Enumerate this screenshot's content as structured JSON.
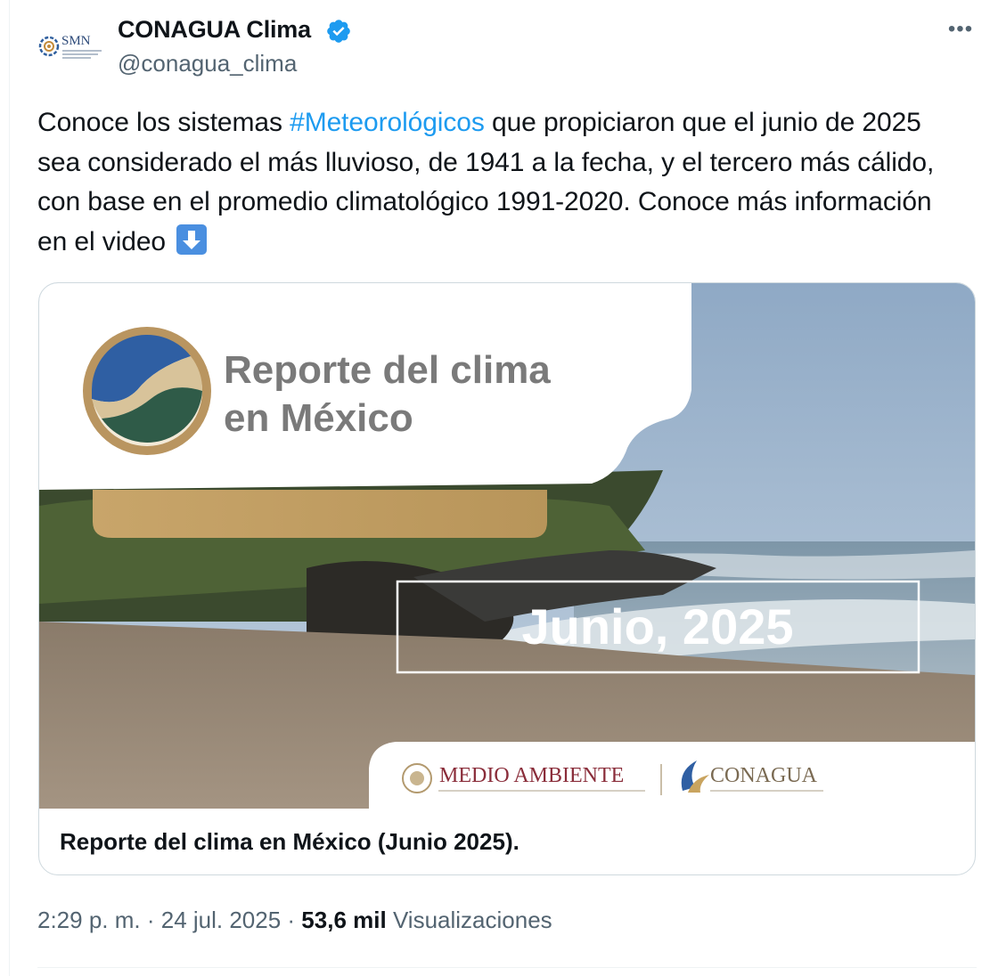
{
  "author": {
    "display_name": "CONAGUA Clima",
    "handle": "@conagua_clima",
    "avatar_text": "SMN"
  },
  "tweet": {
    "text_before": "Conoce los sistemas ",
    "hashtag": "#Meteorológicos",
    "text_after": " que propiciaron que el junio de 2025 sea considerado el más lluvioso, de 1941 a la fecha, y el tercero más cálido, con base en el promedio climatológico 1991-2020. Conoce más información en el video"
  },
  "media": {
    "video_title_line1": "Reporte del clima",
    "video_title_line2": "en México",
    "video_date": "Junio, 2025",
    "footer_logo_1": "MEDIO AMBIENTE",
    "footer_logo_2": "CONAGUA",
    "caption": "Reporte del clima en México (Junio 2025)."
  },
  "footer": {
    "time": "2:29 p. m.",
    "date": "24 jul. 2025",
    "separator": " · ",
    "views_count": "53,6 mil",
    "views_label": "Visualizaciones"
  },
  "colors": {
    "hashtag": "#1d9bf0",
    "verified_badge": "#1d9bf0",
    "secondary_text": "#536471"
  }
}
